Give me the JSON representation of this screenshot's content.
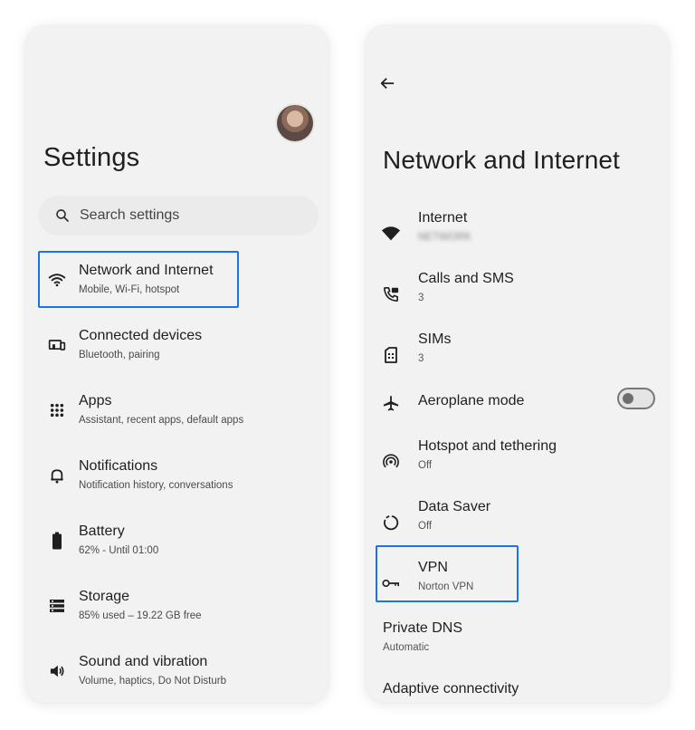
{
  "settings": {
    "title": "Settings",
    "search_placeholder": "Search settings",
    "items": [
      {
        "label": "Network and Internet",
        "sub": "Mobile, Wi-Fi, hotspot"
      },
      {
        "label": "Connected devices",
        "sub": "Bluetooth, pairing"
      },
      {
        "label": "Apps",
        "sub": "Assistant, recent apps, default apps"
      },
      {
        "label": "Notifications",
        "sub": "Notification history, conversations"
      },
      {
        "label": "Battery",
        "sub": "62% - Until 01:00"
      },
      {
        "label": "Storage",
        "sub": "85% used – 19.22 GB free"
      },
      {
        "label": "Sound and vibration",
        "sub": "Volume, haptics, Do Not Disturb"
      }
    ]
  },
  "network": {
    "title": "Network and Internet",
    "items": [
      {
        "label": "Internet",
        "sub": "NETWORK"
      },
      {
        "label": "Calls and SMS",
        "sub": "3"
      },
      {
        "label": "SIMs",
        "sub": "3"
      },
      {
        "label": "Aeroplane mode",
        "toggle_on": false
      },
      {
        "label": "Hotspot and tethering",
        "sub": "Off"
      },
      {
        "label": "Data Saver",
        "sub": "Off"
      },
      {
        "label": "VPN",
        "sub": "Norton VPN"
      },
      {
        "label": "Private DNS",
        "sub": "Automatic"
      },
      {
        "label": "Adaptive connectivity"
      }
    ]
  },
  "colors": {
    "highlight": "#1c73e8",
    "panel_bg": "#f2f2f2",
    "text": "#1f1f1f"
  }
}
